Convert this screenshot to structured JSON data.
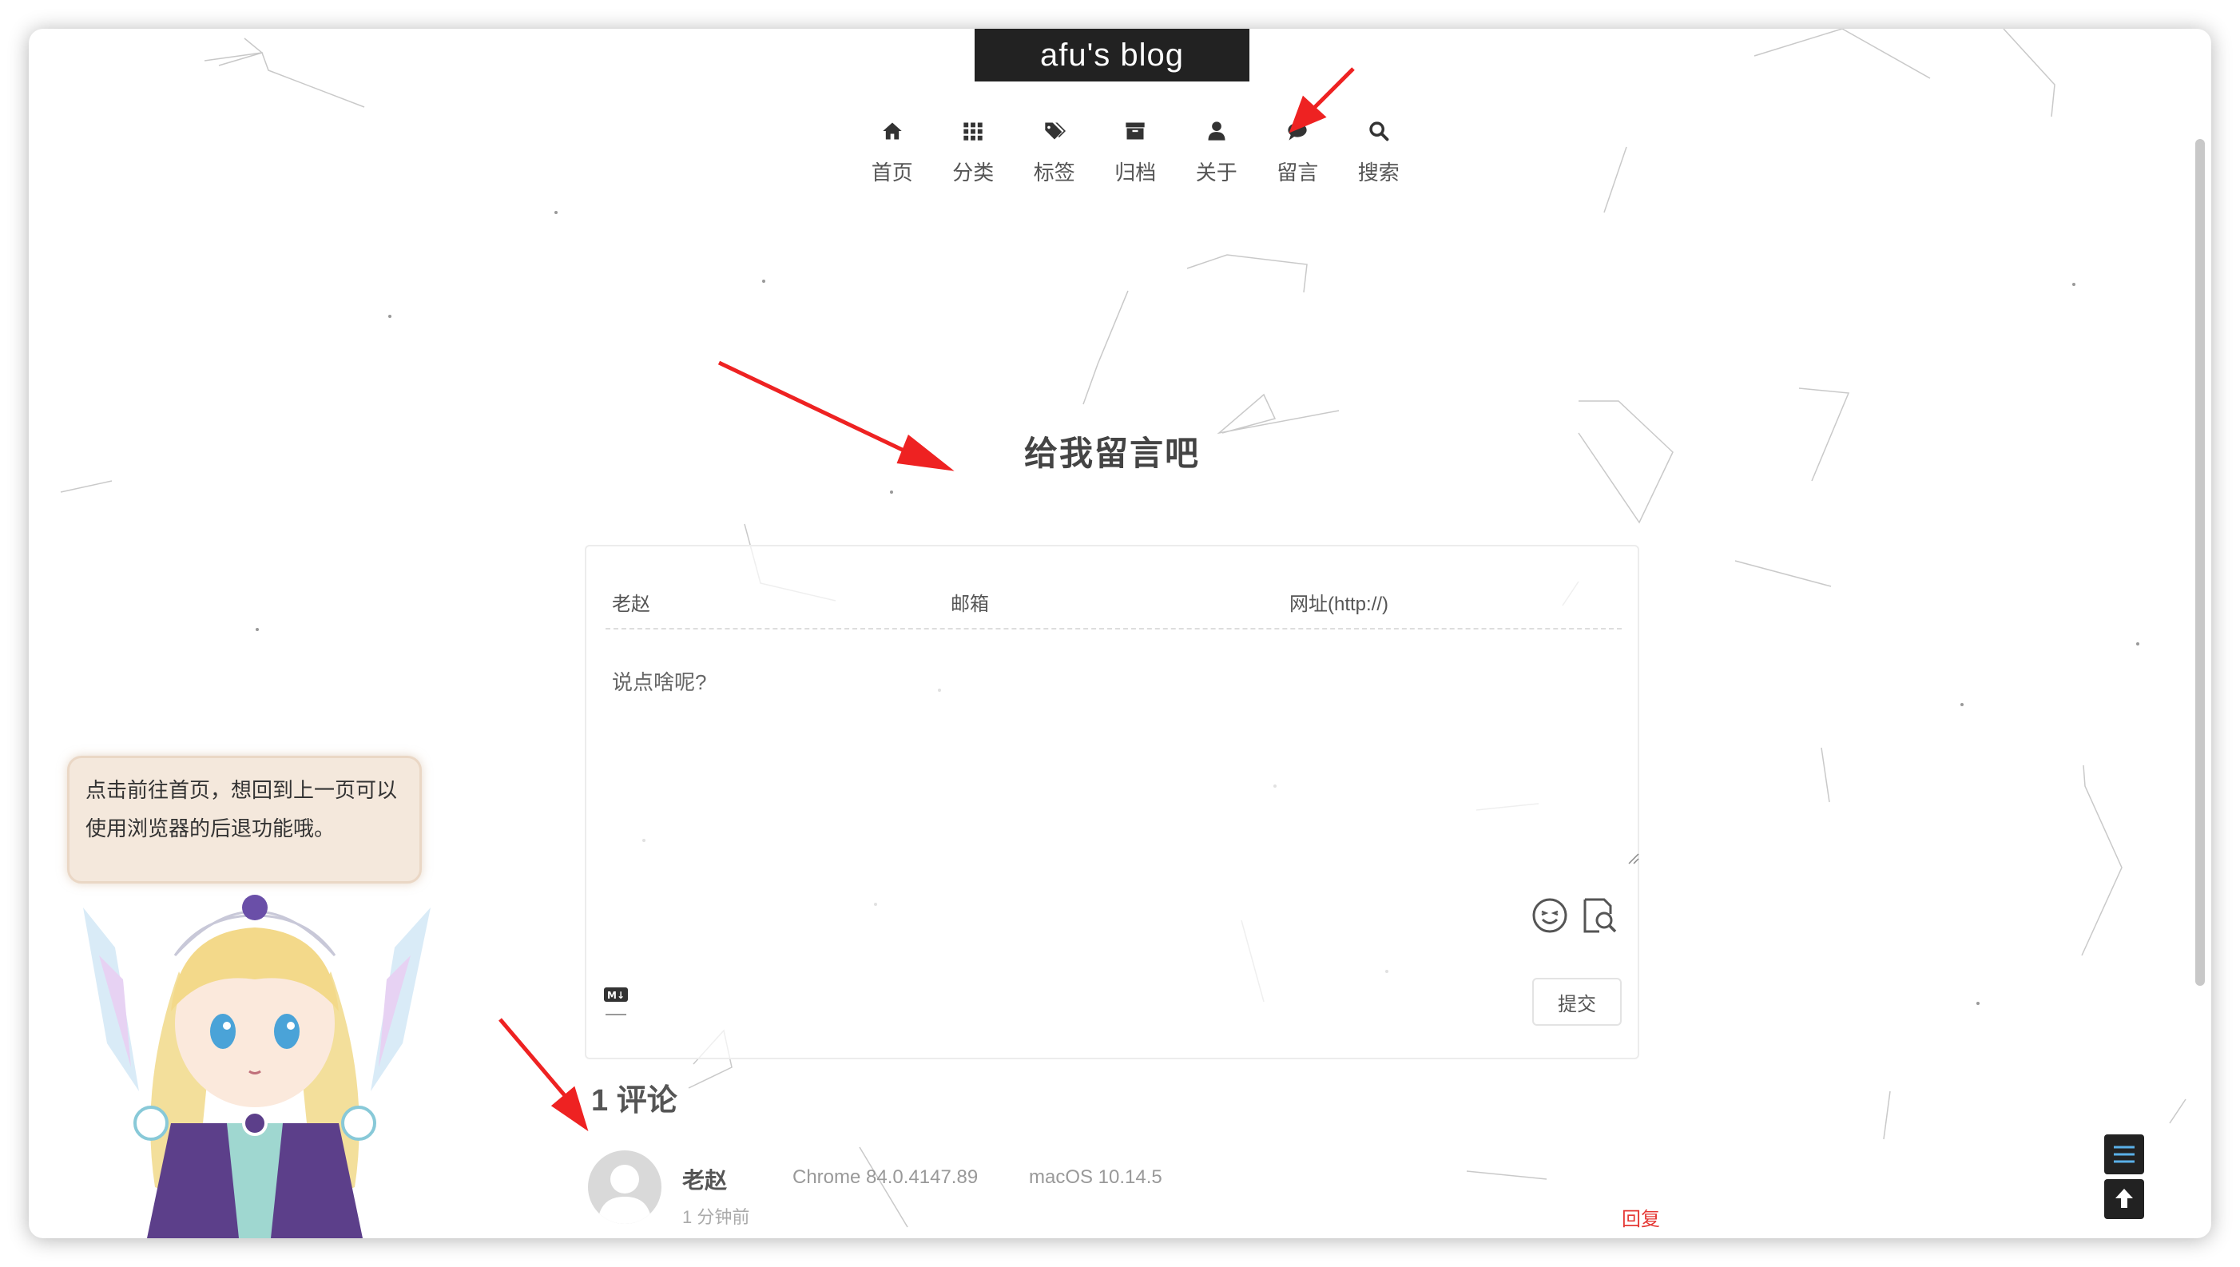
{
  "header": {
    "brand": "afu's blog"
  },
  "nav": [
    {
      "label": "首页",
      "icon": "home-icon"
    },
    {
      "label": "分类",
      "icon": "grid-icon"
    },
    {
      "label": "标签",
      "icon": "tags-icon"
    },
    {
      "label": "归档",
      "icon": "archive-icon"
    },
    {
      "label": "关于",
      "icon": "user-icon"
    },
    {
      "label": "留言",
      "icon": "comment-icon"
    },
    {
      "label": "搜索",
      "icon": "search-icon"
    }
  ],
  "page": {
    "title": "给我留言吧"
  },
  "form": {
    "name_value": "老赵",
    "email_placeholder": "邮箱",
    "url_placeholder": "网址(http://)",
    "message_placeholder": "说点啥呢?",
    "submit_label": "提交"
  },
  "comments": {
    "count_label": "1 评论",
    "items": [
      {
        "author": "老赵",
        "browser": "Chrome 84.0.4147.89",
        "os": "macOS 10.14.5",
        "time": "1 分钟前",
        "reply_label": "回复"
      }
    ]
  },
  "tip": {
    "text": "点击前往首页，想回到上一页可以使用浏览器的后退功能哦。"
  },
  "colors": {
    "accent_red": "#e53935",
    "brand_bg": "#222222",
    "tip_bg": "#f4e8dc"
  }
}
